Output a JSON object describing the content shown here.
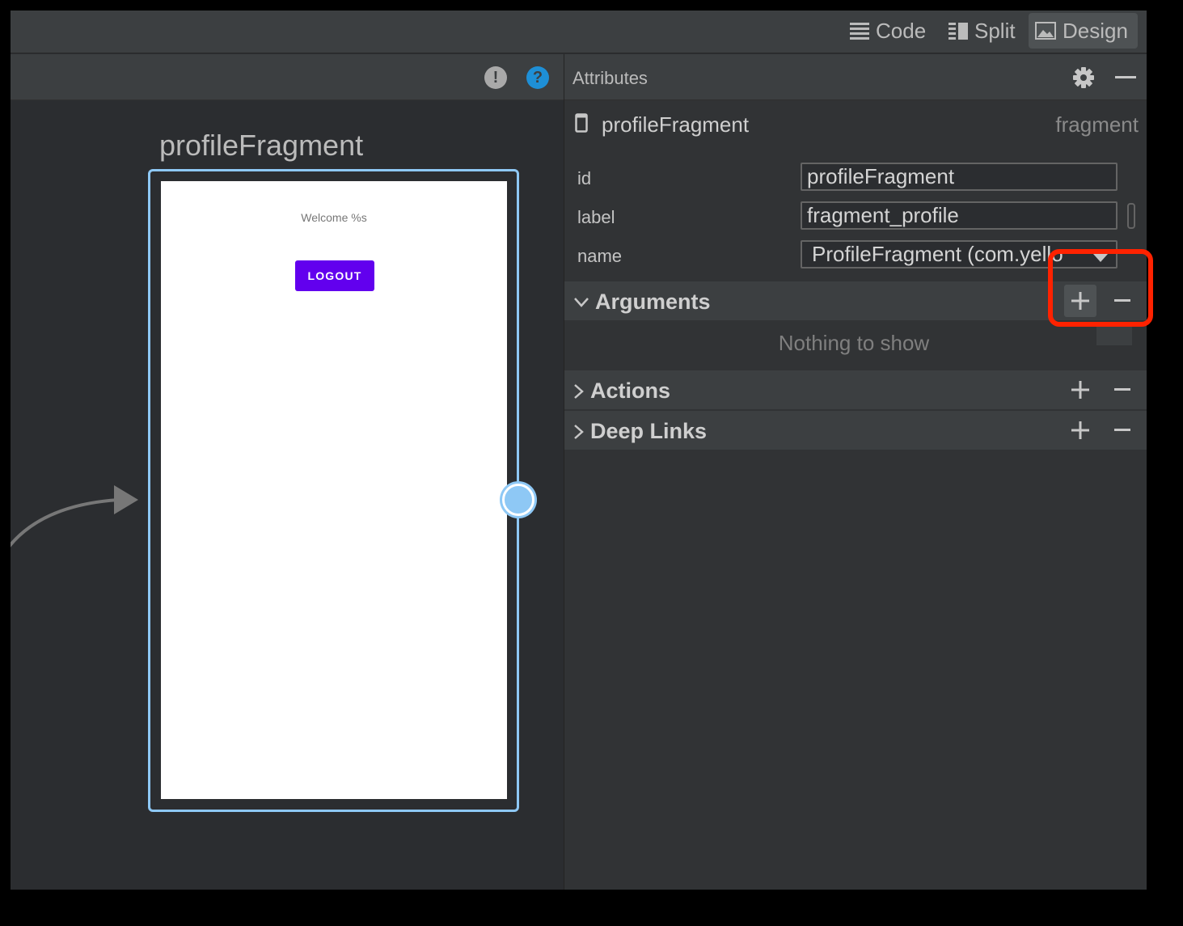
{
  "toolbar": {
    "modes": [
      {
        "label": "Code",
        "icon": "code-lines-icon",
        "active": false
      },
      {
        "label": "Split",
        "icon": "split-view-icon",
        "active": false
      },
      {
        "label": "Design",
        "icon": "image-design-icon",
        "active": true
      }
    ]
  },
  "canvas": {
    "header_icons": [
      "warning-icon",
      "help-icon"
    ],
    "destination_title": "profileFragment",
    "preview": {
      "welcome_text": "Welcome %s",
      "logout_label": "LOGOUT"
    }
  },
  "attributes": {
    "title": "Attributes",
    "component_name": "profileFragment",
    "component_type": "fragment",
    "fields": [
      {
        "label": "id",
        "value": "profileFragment"
      },
      {
        "label": "label",
        "value": "fragment_profile"
      },
      {
        "label": "name",
        "value": "ProfileFragment (com.yello"
      }
    ],
    "sections": [
      {
        "title": "Arguments",
        "expanded": true
      },
      {
        "title": "Actions",
        "expanded": false
      },
      {
        "title": "Deep Links",
        "expanded": false
      }
    ],
    "empty_text": "Nothing to show"
  },
  "colors": {
    "accent_button": "#6200ee",
    "selection": "#8ec8f5",
    "highlight": "#ff2200",
    "help_icon": "#1e8fd6"
  }
}
